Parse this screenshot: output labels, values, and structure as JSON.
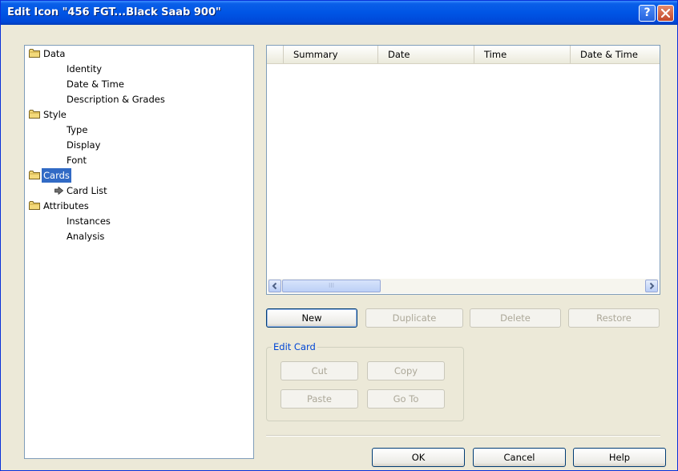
{
  "window": {
    "title": "Edit Icon \"456 FGT...Black Saab 900\"",
    "help_label": "?"
  },
  "tree": {
    "categories": [
      {
        "label": "Data",
        "children": [
          "Identity",
          "Date & Time",
          "Description & Grades"
        ]
      },
      {
        "label": "Style",
        "children": [
          "Type",
          "Display",
          "Font"
        ]
      },
      {
        "label": "Cards",
        "children": [
          "Card List"
        ],
        "selected": true
      },
      {
        "label": "Attributes",
        "children": [
          "Instances",
          "Analysis"
        ]
      }
    ]
  },
  "card_list": {
    "columns": [
      "Summary",
      "Date",
      "Time",
      "Date & Time"
    ],
    "rows": [],
    "scrollbar_thumb_glyph": "III"
  },
  "list_buttons": {
    "new": "New",
    "duplicate": "Duplicate",
    "delete": "Delete",
    "restore": "Restore"
  },
  "edit_card": {
    "title": "Edit Card",
    "cut": "Cut",
    "copy": "Copy",
    "paste": "Paste",
    "goto": "Go To"
  },
  "footer": {
    "ok": "OK",
    "cancel": "Cancel",
    "help": "Help"
  },
  "colors": {
    "title_bar": "#0055E5",
    "selection": "#316AC5",
    "group_title": "#0046D5",
    "dialog_bg": "#ECE9D8"
  }
}
